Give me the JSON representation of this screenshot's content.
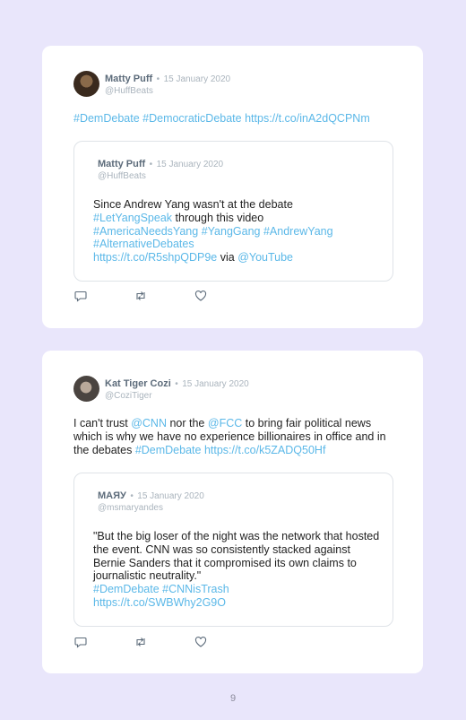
{
  "tweets": [
    {
      "author": "Matty Puff",
      "date": "15 January 2020",
      "handle": "@HuffBeats",
      "text": [
        {
          "t": "#DemDebate",
          "link": true
        },
        {
          "t": " ",
          "link": false
        },
        {
          "t": "#DemocraticDebate",
          "link": true
        },
        {
          "t": " ",
          "link": false
        },
        {
          "t": "https://t.co/inA2dQCPNm",
          "link": true
        }
      ],
      "quote": {
        "author": "Matty Puff",
        "date": "15 January 2020",
        "handle": "@HuffBeats",
        "text": [
          {
            "t": "Since Andrew Yang wasn't at the debate",
            "link": false,
            "br": true
          },
          {
            "t": "#LetYangSpeak",
            "link": true
          },
          {
            "t": " through this video",
            "link": false,
            "br": true
          },
          {
            "t": "#AmericaNeedsYang",
            "link": true
          },
          {
            "t": " ",
            "link": false
          },
          {
            "t": "#YangGang",
            "link": true
          },
          {
            "t": " ",
            "link": false
          },
          {
            "t": "#AndrewYang",
            "link": true,
            "br": true
          },
          {
            "t": "#AlternativeDebates",
            "link": true,
            "br": true
          },
          {
            "t": "https://t.co/R5shpQDP9e",
            "link": true
          },
          {
            "t": " via ",
            "link": false
          },
          {
            "t": "@YouTube",
            "link": true
          }
        ]
      }
    },
    {
      "author": "Kat Tiger Cozi",
      "date": "15 January 2020",
      "handle": "@CoziTiger",
      "text": [
        {
          "t": "I can't trust ",
          "link": false
        },
        {
          "t": "@CNN",
          "link": true
        },
        {
          "t": " nor the ",
          "link": false
        },
        {
          "t": "@FCC",
          "link": true
        },
        {
          "t": " to bring fair political news which is why we have no experience billionaires in office and in the debates ",
          "link": false
        },
        {
          "t": "#DemDebate",
          "link": true
        },
        {
          "t": " ",
          "link": false
        },
        {
          "t": "https://t.co/k5ZADQ50Hf",
          "link": true
        }
      ],
      "quote": {
        "author": "МАЯУ",
        "date": "15 January 2020",
        "handle": "@msmaryandes",
        "text": [
          {
            "t": "\"But the big loser of the night was the network that hosted the event. CNN was so consistently stacked against Bernie Sanders that it compromised its own claims to journalistic neutrality.\"",
            "link": false,
            "br": true
          },
          {
            "t": "#DemDebate",
            "link": true
          },
          {
            "t": " ",
            "link": false
          },
          {
            "t": "#CNNisTrash",
            "link": true,
            "br": true
          },
          {
            "t": "https://t.co/SWBWhy2G9O",
            "link": true
          }
        ]
      }
    }
  ],
  "separator": "•",
  "icons": [
    "reply-icon",
    "retweet-icon",
    "like-icon"
  ],
  "colors": {
    "link": "#5bb8e8",
    "background": "#e9e6fb",
    "card": "#ffffff"
  },
  "page_number": "9"
}
